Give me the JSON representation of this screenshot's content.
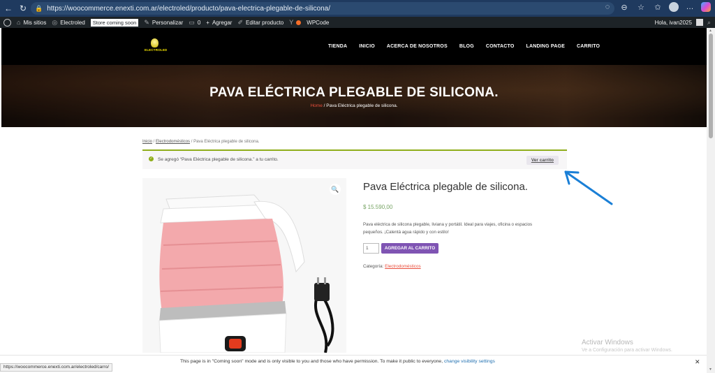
{
  "browser": {
    "url": "https://woocommerce.enexti.com.ar/electroled/producto/pava-electrica-plegable-de-silicona/"
  },
  "admin_bar": {
    "items": [
      "Mis sitios",
      "Electroled"
    ],
    "store_badge": "Store coming soon",
    "customize": "Personalizar",
    "comments_count": "0",
    "add_new": "Agregar",
    "edit_product": "Editar producto",
    "wpcode": "WPCode",
    "greeting": "Hola, ivan2025"
  },
  "header": {
    "logo_text": "ELECTROLED",
    "nav": [
      "TIENDA",
      "INICIO",
      "ACERCA DE NOSOTROS",
      "BLOG",
      "CONTACTO",
      "LANDING PAGE",
      "CARRITO"
    ]
  },
  "hero": {
    "title": "PAVA ELÉCTRICA PLEGABLE DE SILICONA.",
    "crumb_home": "Home",
    "crumb_sep": "/",
    "crumb_current": "Pava Eléctrica plegable de silicona."
  },
  "breadcrumb": {
    "home": "Inicio",
    "sep1": " / ",
    "category": "Electrodomésticos",
    "sep2": " / ",
    "current": "Pava Eléctrica plegable de silicona."
  },
  "notice": {
    "message": "Se agregó “Pava Eléctrica plegable de silicona.” a tu carrito.",
    "view_cart": "Ver carrito"
  },
  "product": {
    "title": "Pava Eléctrica plegable de silicona.",
    "price": "$ 15.590,00",
    "description": "Pava eléctrica de silicona plegable, liviana y portátil. Ideal para viajes, oficina o espacios pequeños. ¡Calentá agua rápido y con estilo!",
    "qty": "1",
    "add_to_cart": "AGREGAR AL CARRITO",
    "category_label": "Categoría: ",
    "category": "Electrodomésticos"
  },
  "watermark": {
    "title": "Activar Windows",
    "subtitle": "Ve a Configuración para activar Windows."
  },
  "coming_soon": {
    "message": "This page is in \"Coming soon\" mode and is only visible to you and those who have permission. To make it public to everyone, ",
    "link": "change visibility settings"
  },
  "status_url": "https://woocommerce.enexti.com.ar/electroled/carro/",
  "colors": {
    "accent_purple": "#7f54b3",
    "price_green": "#77a464",
    "notice_green": "#8fae1b",
    "link_red": "#e94e3c",
    "annotation_blue": "#1a7fd6"
  }
}
